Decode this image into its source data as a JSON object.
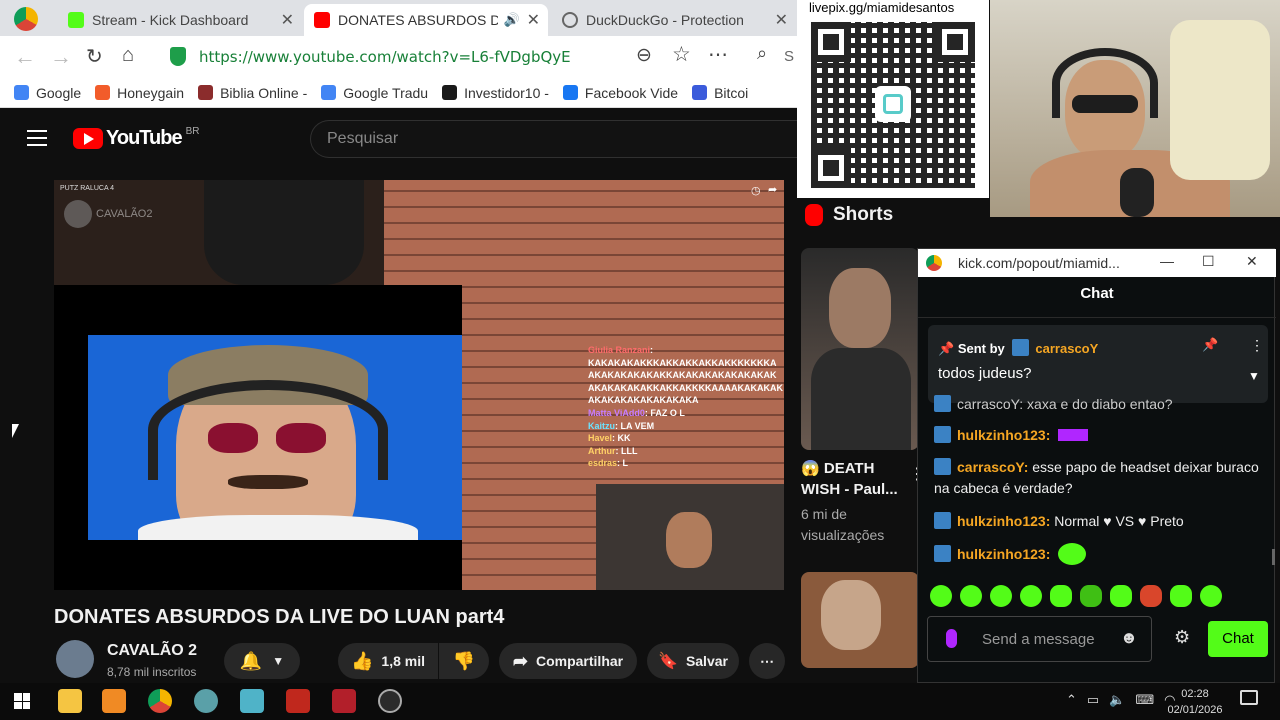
{
  "tabs": [
    {
      "title": "Stream - Kick Dashboard",
      "color": "#53fc18"
    },
    {
      "title": "DONATES ABSURDOS D",
      "color": "#ff0000"
    },
    {
      "title": "DuckDuckGo - Protection",
      "color": "#888888"
    }
  ],
  "address": {
    "url": "https://www.youtube.com/watch?v=L6-fVDgbQyE",
    "search_partial": "S"
  },
  "bookmarks": [
    {
      "label": "Google",
      "color": "#4285f4"
    },
    {
      "label": "Honeygain",
      "color": "#f25c2a"
    },
    {
      "label": "Biblia Online -",
      "color": "#8b2c2c"
    },
    {
      "label": "Google Tradu",
      "color": "#4285f4"
    },
    {
      "label": "Investidor10 -",
      "color": "#1a1a1a"
    },
    {
      "label": "Facebook Vide",
      "color": "#1877f2"
    },
    {
      "label": "Bitcoi",
      "color": "#3b5bdb"
    }
  ],
  "youtube": {
    "logo_text": "YouTube",
    "region": "BR",
    "search_placeholder": "Pesquisar",
    "video_title": "DONATES ABSURDOS DA LIVE DO LUAN part4",
    "channel_name": "CAVALÃO 2",
    "subscribers": "8,78 mil inscritos",
    "likes": "1,8 mil",
    "share_label": "Compartilhar",
    "save_label": "Salvar",
    "shorts_label": "Shorts",
    "short_title_line1": "DEATH",
    "short_title_line2": "WISH - Paul...",
    "short_views_line1": "6 mi de",
    "short_views_line2": "visualizações"
  },
  "overlay": {
    "livepix": "livepix.gg/miamidesantos",
    "video_watermark": "PUTZ RALUCA 4",
    "video_channel_tag": "CAVALÃO2",
    "chat_lines": [
      {
        "name": "Giulia Ranzani",
        "text": ":"
      },
      {
        "name": "",
        "text": "KAKAKAKAKKKAKKAKKAKKAKKKKKKKA"
      },
      {
        "name": "",
        "text": "AKAKAKAKAKAKKAKAKAKAKAKAKAKAK"
      },
      {
        "name": "",
        "text": "AKAKAKAKAKKAKKAKKKKAAAAKAKAKAK"
      },
      {
        "name": "",
        "text": "AKAKAKAKAKAKAKAKA"
      },
      {
        "name": "Matta ViAdd0",
        "text": ": FAZ O L"
      },
      {
        "name": "Kaitzu",
        "text": ": LA VEM"
      },
      {
        "name": "Havel",
        "text": ": KK"
      },
      {
        "name": "Arthur",
        "text": ": LLL"
      },
      {
        "name": "esdras",
        "text": ": L"
      }
    ]
  },
  "chat": {
    "window_url": "kick.com/popout/miamid...",
    "title": "Chat",
    "pinned_prefix": "Sent by",
    "pinned_user": "carrascoY",
    "pinned_text": "todos judeus?",
    "partial_line": "carrascoY: xaxa e do diabo entao?",
    "messages": [
      {
        "user": "hulkzinho123",
        "text": "",
        "user_color": "#f5a623"
      },
      {
        "user": "carrascoY",
        "text": "esse papo de headset deixar buraco na cabeca é verdade?",
        "user_color": "#f5a623"
      },
      {
        "user": "hulkzinho123",
        "text": "Normal  ♥  VS  ♥  Preto",
        "user_color": "#f5a623"
      },
      {
        "user": "hulkzinho123",
        "text": "",
        "user_color": "#f5a623"
      }
    ],
    "input_placeholder": "Send a message",
    "send_label": "Chat",
    "accent": "#53fc18"
  },
  "taskbar": {
    "time": "02:28",
    "date": "02/01/2026"
  }
}
